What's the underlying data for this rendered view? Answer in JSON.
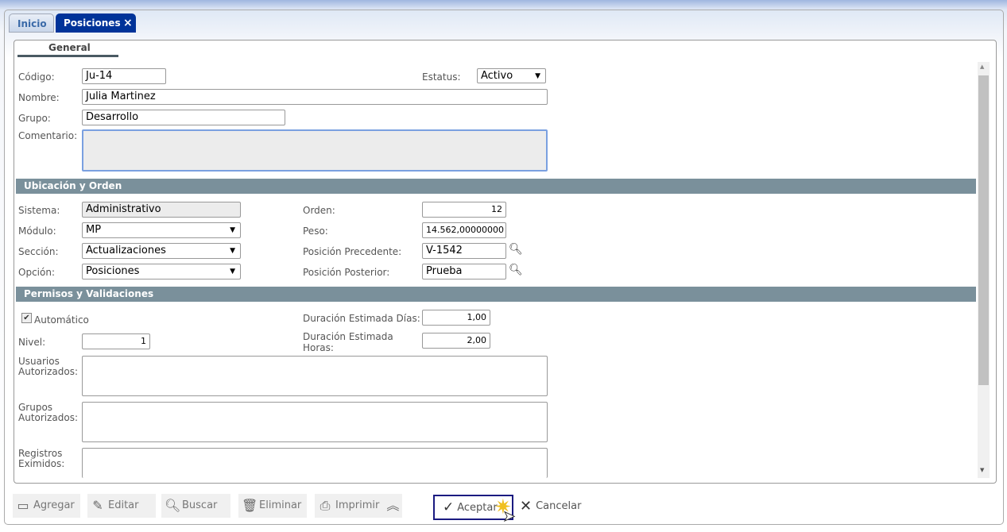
{
  "tabs": [
    {
      "label": "Inicio"
    },
    {
      "label": "Posiciones",
      "close": "×"
    }
  ],
  "subtab": "General",
  "form": {
    "codigo": {
      "label": "Código:",
      "value": "Ju-14"
    },
    "estatus": {
      "label": "Estatus:",
      "value": "Activo"
    },
    "nombre": {
      "label": "Nombre:",
      "value": "Julia Martinez"
    },
    "grupo": {
      "label": "Grupo:",
      "value": "Desarrollo"
    },
    "comentario": {
      "label": "Comentario:",
      "value": ""
    }
  },
  "sections": [
    "Ubicación y Orden",
    "Permisos y Validaciones"
  ],
  "ubicacion": {
    "sistema": {
      "label": "Sistema:",
      "value": "Administrativo"
    },
    "modulo": {
      "label": "Módulo:",
      "value": "MP"
    },
    "seccion": {
      "label": "Sección:",
      "value": "Actualizaciones"
    },
    "opcion": {
      "label": "Opción:",
      "value": "Posiciones"
    },
    "orden": {
      "label": "Orden:",
      "value": "12"
    },
    "peso": {
      "label": "Peso:",
      "value": "14.562,00000000"
    },
    "precedente": {
      "label": "Posición Precedente:",
      "value": "V-1542"
    },
    "posterior": {
      "label": "Posición Posterior:",
      "value": "Prueba"
    }
  },
  "permisos": {
    "automatico": {
      "label": "Automático",
      "checked": true
    },
    "nivel": {
      "label": "Nivel:",
      "value": "1"
    },
    "dias": {
      "label": "Duración Estimada Días:",
      "value": "1,00"
    },
    "horas": {
      "label1": "Duración Estimada",
      "label2": "Horas:",
      "value": "2,00"
    },
    "usuarios": {
      "label1": "Usuarios",
      "label2": "Autorizados:"
    },
    "grupos": {
      "label1": "Grupos",
      "label2": "Autorizados:"
    },
    "registros": {
      "label1": "Registros",
      "label2": "Eximidos:"
    }
  },
  "toolbar": {
    "agregar": "Agregar",
    "editar": "Editar",
    "buscar": "Buscar",
    "eliminar": "Eliminar",
    "imprimir": "Imprimir",
    "aceptar": "Aceptar",
    "cancelar": "Cancelar"
  },
  "colors": {
    "active_tab": "#003399",
    "section_bar": "#7a909b",
    "focus_border": "#1a1a80"
  }
}
